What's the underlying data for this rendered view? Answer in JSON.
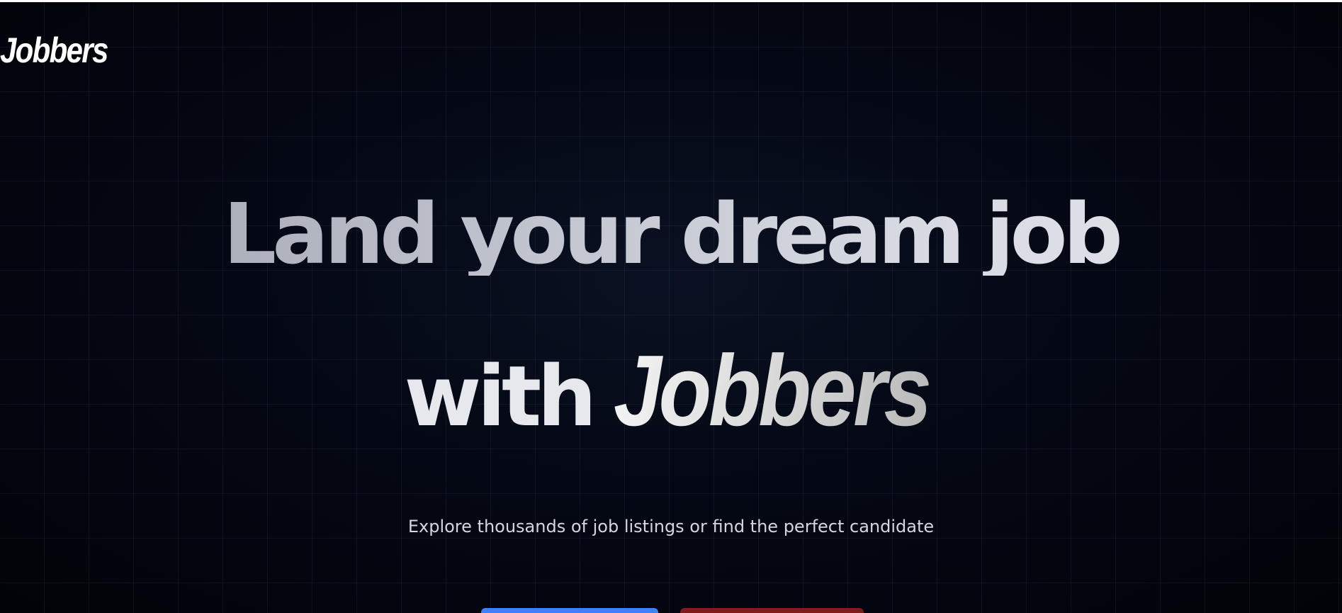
{
  "header": {
    "logo_text": "Jobbers"
  },
  "hero": {
    "headline_line1": "Land your dream job",
    "headline_line2_prefix": "with",
    "headline_line2_brand": "Jobbers",
    "subtitle": "Explore thousands of job listings or find the perfect candidate"
  },
  "actions": {
    "primary_label": "",
    "secondary_label": ""
  },
  "colors": {
    "background": "#040814",
    "primary_button": "#3b82f6",
    "secondary_button": "#7f1d1d",
    "text": "#ffffff"
  }
}
